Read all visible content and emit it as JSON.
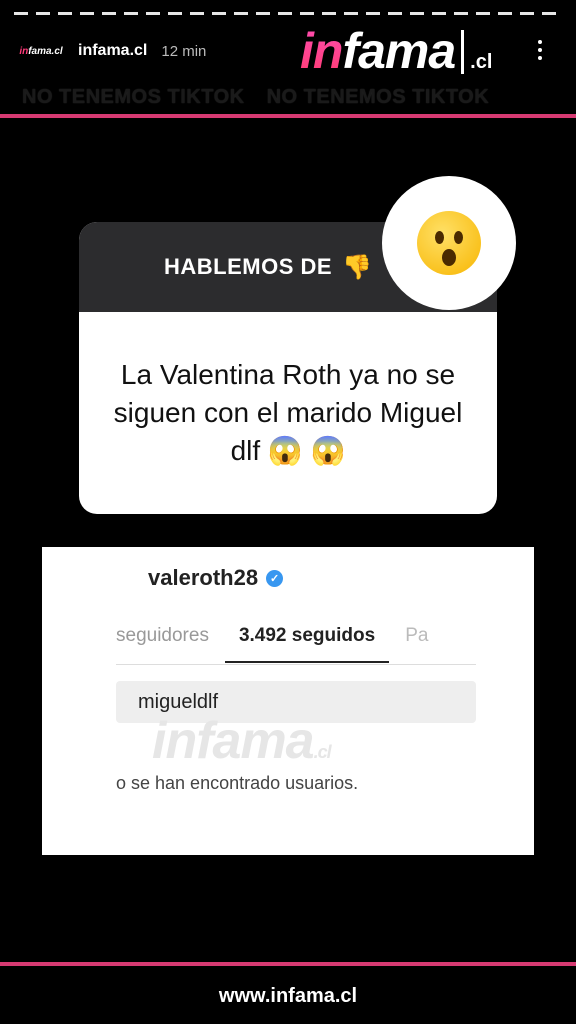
{
  "story": {
    "account_avatar_text_a": "in",
    "account_avatar_text_b": "fama.cl",
    "username": "infama.cl",
    "time": "12 min"
  },
  "brand": {
    "logo_in": "in",
    "logo_fama": "fama",
    "logo_cl": ".cl",
    "banner_left": "NO TENEMOS TIKTOK",
    "banner_right": "NO TENEMOS TIKTOK",
    "accent_color": "#d63a72"
  },
  "question_card": {
    "title": "HABLEMOS DE",
    "title_icon": "thumbs-down-emoji",
    "text": "La Valentina Roth ya no se siguen con el marido Miguel dlf 😱 😱",
    "sticker_emoji": "surprised-face"
  },
  "screenshot": {
    "username": "valeroth28",
    "tab_followers": "seguidores",
    "tab_following": "3.492 seguidos",
    "tab_more": "Pa",
    "search_value": "migueldlf",
    "watermark": "infama",
    "watermark_cl": ".cl",
    "no_results": "o se han encontrado usuarios."
  },
  "footer": {
    "url": "www.infama.cl"
  }
}
